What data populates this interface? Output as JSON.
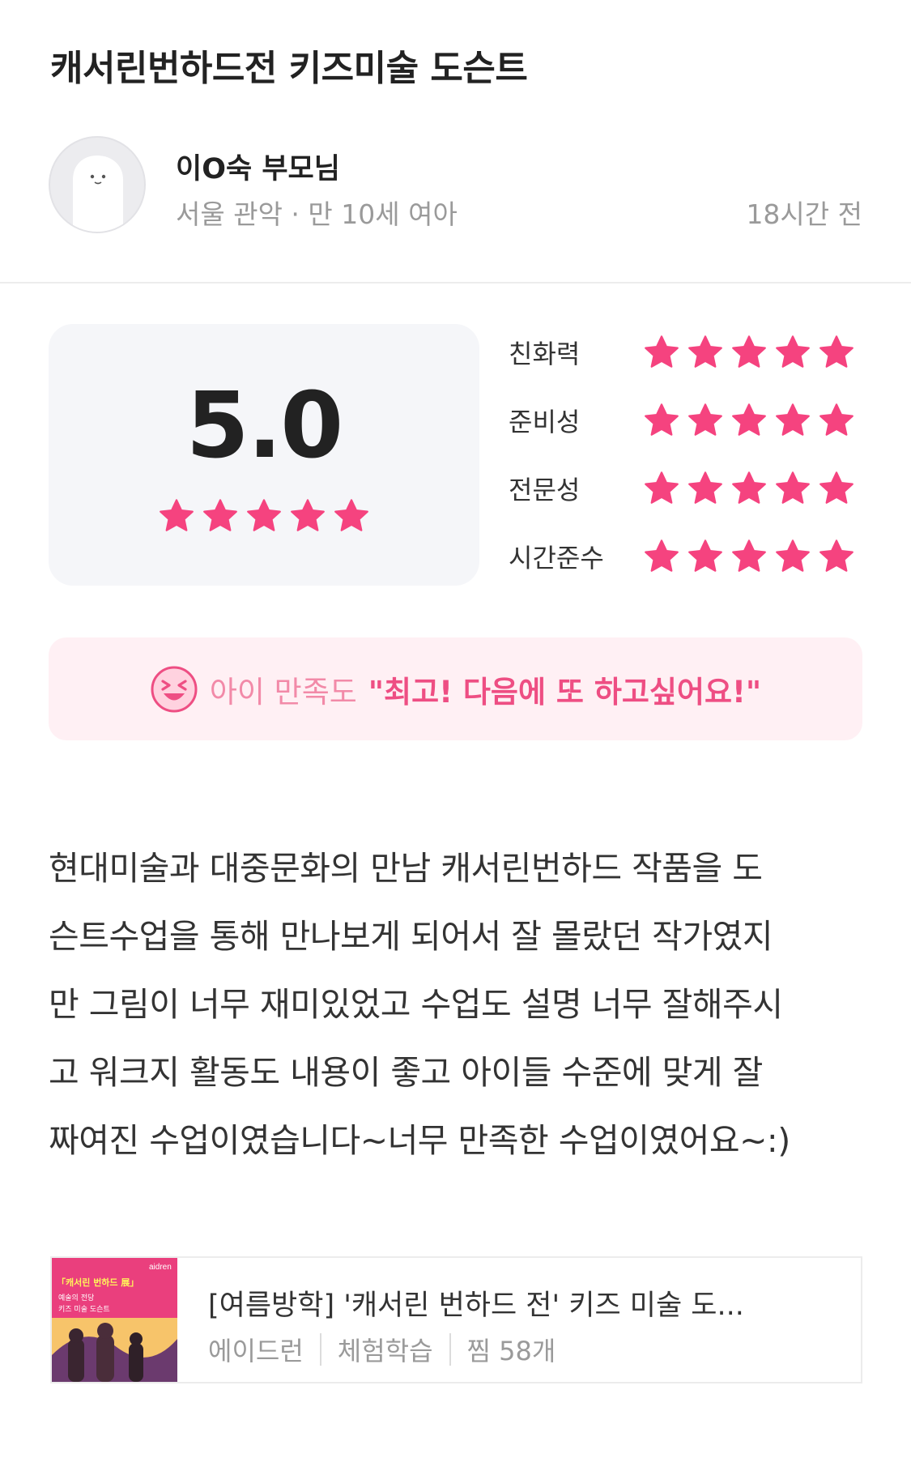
{
  "page_title": "캐서린번하드전 키즈미술 도슨트",
  "author": {
    "name": "이O숙 부모님",
    "meta": "서울 관악 · 만 10세 여아",
    "time": "18시간 전"
  },
  "rating": {
    "score": "5.0",
    "overall_stars": 5,
    "criteria": [
      {
        "label": "친화력",
        "stars": 5
      },
      {
        "label": "준비성",
        "stars": 5
      },
      {
        "label": "전문성",
        "stars": 5
      },
      {
        "label": "시간준수",
        "stars": 5
      }
    ]
  },
  "satisfaction": {
    "label": "아이 만족도",
    "quote": "\"최고! 다음에 또 하고싶어요!\"",
    "icon": "laughing-face-icon"
  },
  "review_lines": [
    "현대미술과 대중문화의 만남 캐서린번하드 작품을 도",
    "슨트수업을 통해 만나보게 되어서 잘 몰랐던 작가였지",
    "만 그림이 너무 재미있었고 수업도 설명 너무 잘해주시",
    "고 워크지 활동도 내용이 좋고 아이들 수준에 맞게 잘",
    "짜여진 수업이였습니다~너무 만족한 수업이였어요~:)"
  ],
  "product": {
    "title": "[여름방학] '캐서린 번하드 전' 키즈 미술 도...",
    "provider": "에이드런",
    "category": "체험학습",
    "likes": "찜 58개",
    "thumbnail": {
      "brand": "aidren",
      "headline": "「캐서린 번하드 展」",
      "line1": "예술의 전당",
      "line2": "키즈 미술 도슨트"
    }
  },
  "colors": {
    "star": "#f5437f",
    "accent_pink": "#ee4e83",
    "satisfaction_bg": "#fff0f4",
    "score_bg": "#f5f6f9"
  }
}
